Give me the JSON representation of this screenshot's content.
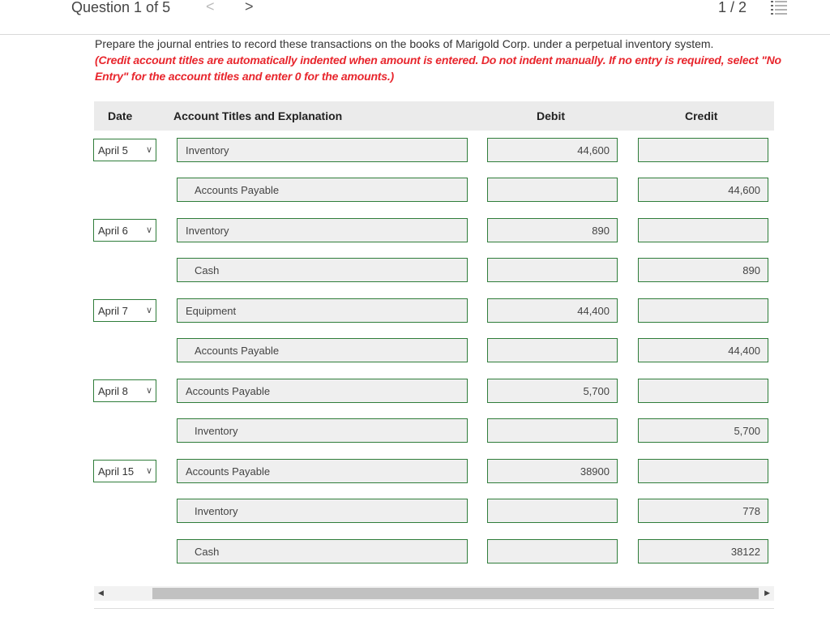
{
  "header": {
    "question_label": "Question 1 of 5",
    "prev_glyph": "<",
    "next_glyph": ">",
    "page_indicator": "1 / 2"
  },
  "instructions": {
    "main": "Prepare the journal entries to record these transactions on the books of Marigold Corp. under a perpetual inventory system.",
    "note": "(Credit account titles are automatically indented when amount is entered. Do not indent manually. If no entry is required, select \"No Entry\" for the account titles and enter 0 for the amounts.)"
  },
  "table": {
    "headers": {
      "date": "Date",
      "account": "Account Titles and Explanation",
      "debit": "Debit",
      "credit": "Credit"
    },
    "rows": [
      {
        "date": "April 5",
        "account": "Inventory",
        "debit": "44,600",
        "credit": ""
      },
      {
        "date": "",
        "account": "Accounts Payable",
        "debit": "",
        "credit": "44,600"
      },
      {
        "date": "April 6",
        "account": "Inventory",
        "debit": "890",
        "credit": ""
      },
      {
        "date": "",
        "account": "Cash",
        "debit": "",
        "credit": "890"
      },
      {
        "date": "April 7",
        "account": "Equipment",
        "debit": "44,400",
        "credit": ""
      },
      {
        "date": "",
        "account": "Accounts Payable",
        "debit": "",
        "credit": "44,400"
      },
      {
        "date": "April 8",
        "account": "Accounts Payable",
        "debit": "5,700",
        "credit": ""
      },
      {
        "date": "",
        "account": "Inventory",
        "debit": "",
        "credit": "5,700"
      },
      {
        "date": "April 15",
        "account": "Accounts Payable",
        "debit": "38900",
        "credit": ""
      },
      {
        "date": "",
        "account": "Inventory",
        "debit": "",
        "credit": "778"
      },
      {
        "date": "",
        "account": "Cash",
        "debit": "",
        "credit": "38122"
      }
    ]
  },
  "colors": {
    "field_border": "#2f7d3a",
    "instruction_red": "#e8262d",
    "header_bg": "#ebebeb"
  }
}
